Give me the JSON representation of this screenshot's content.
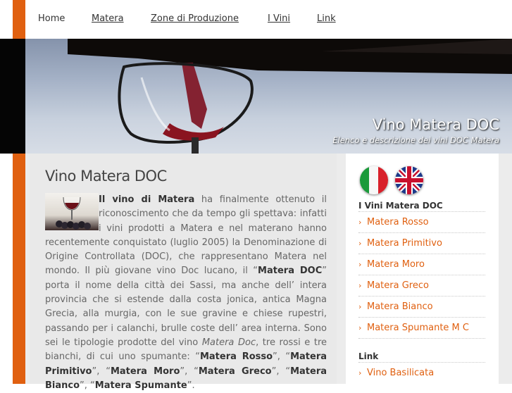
{
  "nav": {
    "items": [
      {
        "label": "Home"
      },
      {
        "label": "Matera"
      },
      {
        "label": "Zone di Produzione"
      },
      {
        "label": "I Vini"
      },
      {
        "label": "Link"
      }
    ]
  },
  "banner": {
    "title": "Vino Matera DOC",
    "subtitle": "Elenco e descrizione dei vini DOC Matera"
  },
  "main": {
    "title": "Vino Matera DOC",
    "paragraph": {
      "t1": "Il vino di Matera",
      "t2": " ha finalmente ottenuto il riconoscimento che da tempo gli spettava: infatti i vini prodotti a Matera e nel materano hanno recentemente conquistato (luglio 2005) la Denominazione di Origine Controllata (DOC), che rappresentano Matera nel mondo. Il più giovane vino Doc lucano, il “",
      "t3": "Matera DOC",
      "t4": "” porta il nome della città dei Sassi, ma anche dell’ intera provincia che si estende dalla costa jonica, antica Magna Grecia, alla murgia, con le sue gravine e chiese rupestri, passando per i calanchi, brulle coste dell’ area interna. Sono sei le tipologie prodotte del vino ",
      "t5": "Matera Doc",
      "t6": ", tre rossi e tre bianchi, di cui uno spumante: “",
      "t7": "Matera Rosso",
      "t8": "”, “",
      "t9": "Matera Primitivo",
      "t10": "”, “",
      "t11": "Matera Moro",
      "t12": "”, “",
      "t13": "Matera Greco",
      "t14": "”, “",
      "t15": "Matera Bianco",
      "t16": "”, “",
      "t17": "Matera Spumante",
      "t18": "”."
    }
  },
  "sidebar": {
    "vini_heading": "I Vini Matera DOC",
    "vini": [
      "Matera Rosso",
      "Matera Primitivo",
      "Matera Moro",
      "Matera Greco",
      "Matera Bianco",
      "Matera Spumante M C"
    ],
    "link_heading": "Link",
    "links": [
      "Vino Basilicata"
    ],
    "arrow": "›"
  },
  "colors": {
    "accent": "#e06010"
  }
}
